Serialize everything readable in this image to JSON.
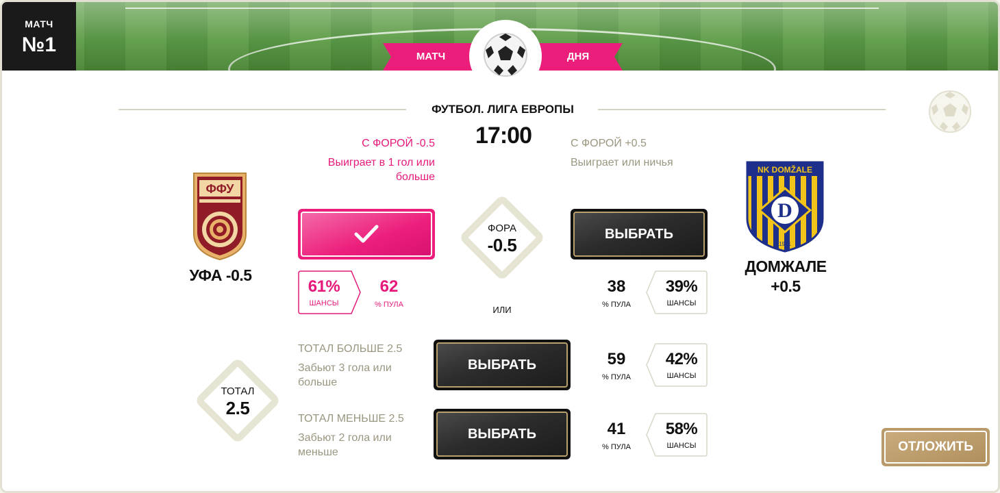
{
  "header": {
    "match_label": "МАТЧ",
    "match_number": "№1",
    "ribbon_left": "МАТЧ",
    "ribbon_right": "ДНЯ"
  },
  "event": {
    "league": "ФУТБОЛ. ЛИГА ЕВРОПЫ",
    "time": "17:00"
  },
  "home": {
    "name": "УФА -0.5",
    "handicap_title": "С ФОРОЙ -0.5",
    "handicap_desc": "Выиграет в 1 гол или больше",
    "chance_pct": "61%",
    "chance_label": "ШАНСЫ",
    "pool_value": "62",
    "pool_label": "% ПУЛА",
    "crest_text": "ФФУ",
    "selected": true
  },
  "away": {
    "name": "ДОМЖАЛЕ +0.5",
    "handicap_title": "С ФОРОЙ +0.5",
    "handicap_desc": "Выиграет или ничья",
    "select_label": "ВЫБРАТЬ",
    "chance_pct": "39%",
    "chance_label": "ШАНСЫ",
    "pool_value": "38",
    "pool_label": "% ПУЛА",
    "crest_top": "NK DOMŽALE",
    "crest_letter": "D",
    "crest_year": "1921"
  },
  "handicap": {
    "label": "ФОРА",
    "value": "-0.5"
  },
  "or_label": "ИЛИ",
  "total": {
    "label": "ТОТАЛ",
    "value": "2.5",
    "over": {
      "title": "ТОТАЛ БОЛЬШЕ 2.5",
      "desc": "Забьют 3 гола или больше",
      "select_label": "ВЫБРАТЬ",
      "pool_value": "59",
      "pool_label": "% ПУЛА",
      "chance_pct": "42%",
      "chance_label": "ШАНСЫ"
    },
    "under": {
      "title": "ТОТАЛ МЕНЬШЕ 2.5",
      "desc": "Забьют 2 гола или меньше",
      "select_label": "ВЫБРАТЬ",
      "pool_value": "41",
      "pool_label": "% ПУЛА",
      "chance_pct": "58%",
      "chance_label": "ШАНСЫ"
    }
  },
  "postpone_label": "ОТЛОЖИТЬ",
  "colors": {
    "accent_pink": "#ec1e7c",
    "gold": "#b99a6a",
    "olive_text": "#9a9680"
  }
}
